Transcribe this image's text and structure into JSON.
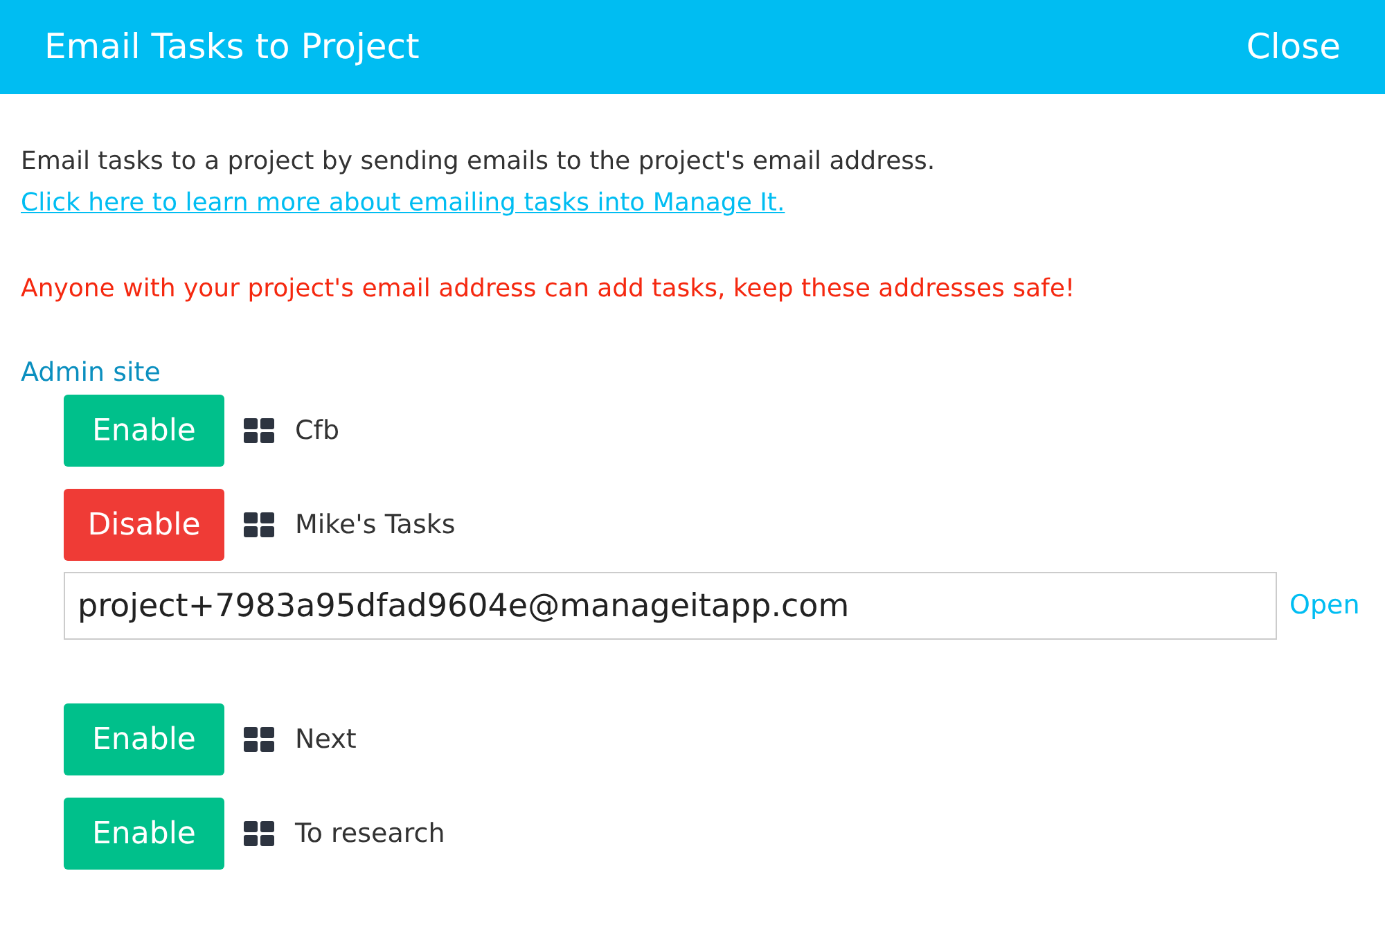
{
  "header": {
    "title": "Email Tasks to Project",
    "close": "Close"
  },
  "intro": "Email tasks to a project by sending emails to the project's email address.",
  "learn_link": "Click here to learn more about emailing tasks into Manage It.",
  "warning": "Anyone with your project's email address can add tasks, keep these addresses safe!",
  "group": {
    "name": "Admin site",
    "projects": [
      {
        "name": "Cfb",
        "enabled": false,
        "button": "Enable"
      },
      {
        "name": "Mike's Tasks",
        "enabled": true,
        "button": "Disable",
        "email": "project+7983a95dfad9604e@manageitapp.com",
        "open": "Open"
      },
      {
        "name": "Next",
        "enabled": false,
        "button": "Enable"
      },
      {
        "name": "To research",
        "enabled": false,
        "button": "Enable"
      }
    ]
  }
}
